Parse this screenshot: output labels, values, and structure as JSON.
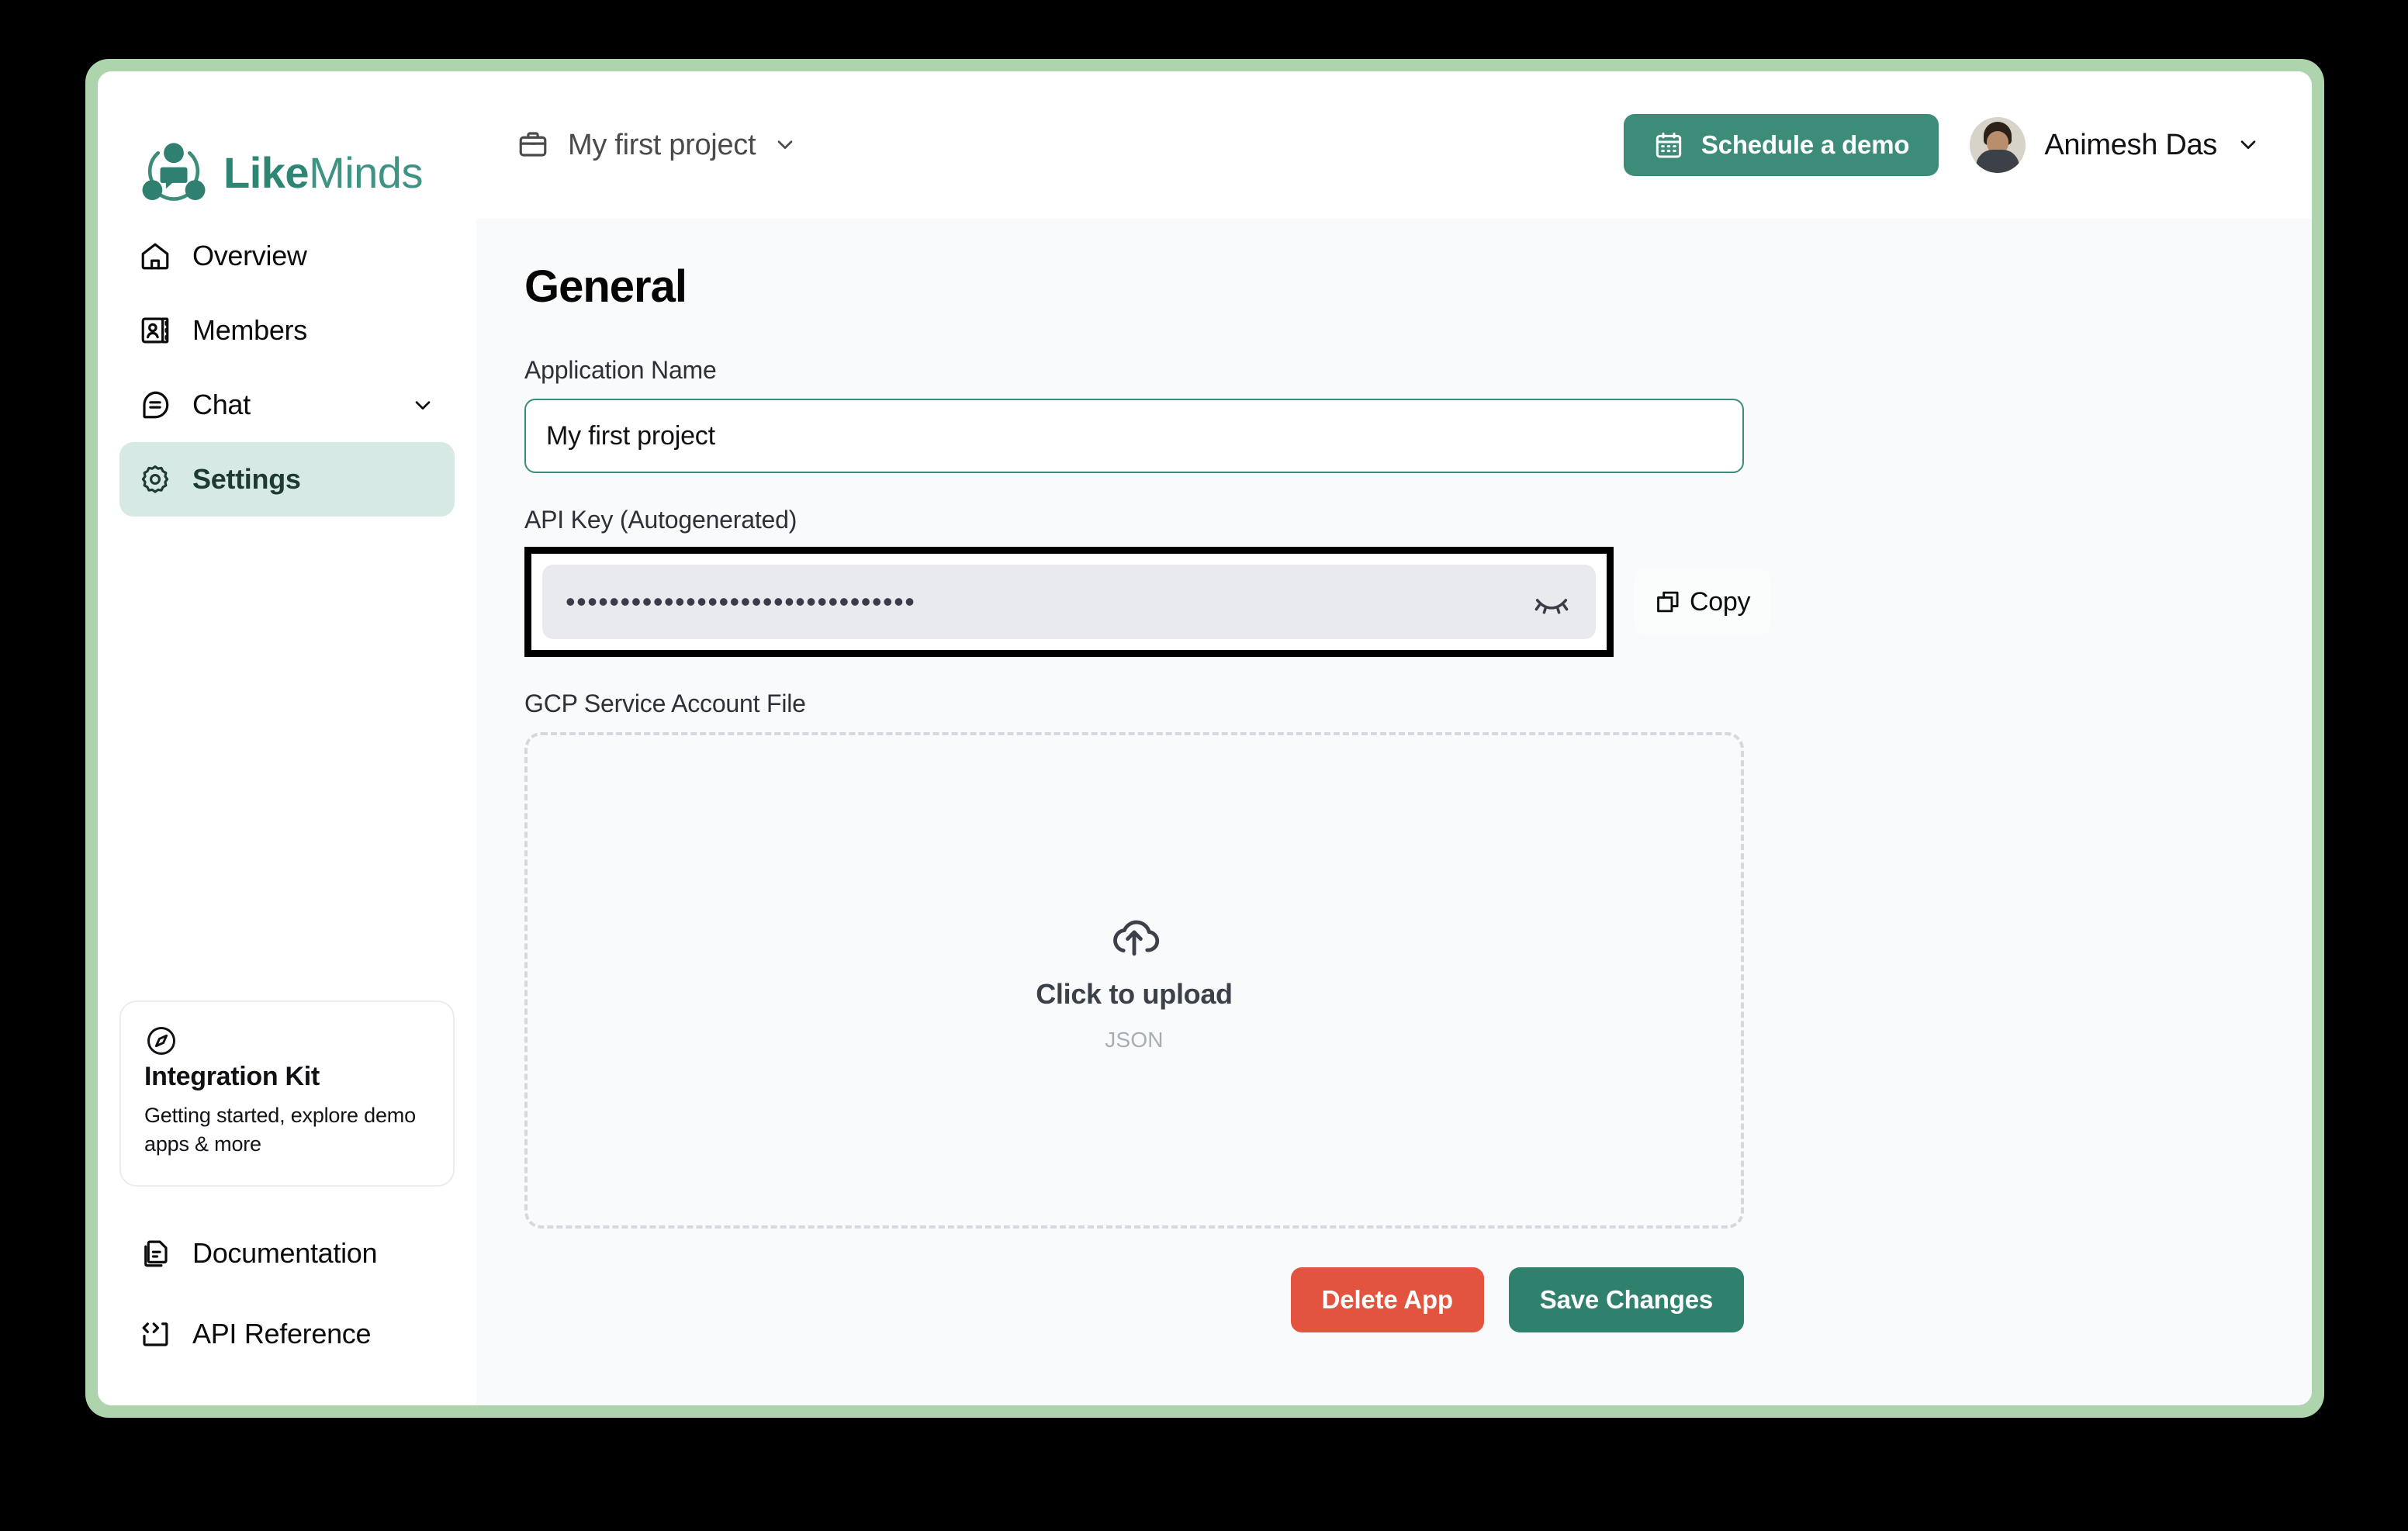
{
  "brand": {
    "name_bold": "Like",
    "name_light": "Minds",
    "logo_icon": "likeminds-logo-icon"
  },
  "sidebar": {
    "items": [
      {
        "label": "Overview",
        "icon": "home-icon",
        "active": false,
        "chevron": false
      },
      {
        "label": "Members",
        "icon": "contacts-icon",
        "active": false,
        "chevron": false
      },
      {
        "label": "Chat",
        "icon": "chat-bubble-icon",
        "active": false,
        "chevron": true
      },
      {
        "label": "Settings",
        "icon": "gear-icon",
        "active": true,
        "chevron": false
      }
    ],
    "integration_kit": {
      "icon": "compass-icon",
      "title": "Integration Kit",
      "subtitle": "Getting started, explore demo apps & more"
    },
    "bottom_items": [
      {
        "label": "Documentation",
        "icon": "document-icon"
      },
      {
        "label": "API Reference",
        "icon": "code-brackets-icon"
      }
    ]
  },
  "topbar": {
    "project": {
      "icon": "briefcase-icon",
      "name": "My first project",
      "chevron_icon": "chevron-down-icon"
    },
    "schedule_demo": {
      "label": "Schedule a demo",
      "icon": "calendar-icon"
    },
    "user": {
      "name": "Animesh Das",
      "avatar_icon": "avatar",
      "chevron_icon": "chevron-down-icon"
    }
  },
  "content": {
    "page_title": "General",
    "application_name": {
      "label": "Application Name",
      "value": "My first project",
      "placeholder": "Application Name"
    },
    "api_key": {
      "label": "API Key (Autogenerated)",
      "masked_value": "••••••••••••••••••••••••••••••••",
      "toggle_icon": "eye-off-icon",
      "copy_label": "Copy",
      "copy_icon": "copy-icon"
    },
    "gcp_file": {
      "label": "GCP Service Account File",
      "upload_icon": "cloud-upload-icon",
      "upload_primary": "Click to upload",
      "upload_hint": "JSON"
    },
    "actions": {
      "delete_label": "Delete App",
      "save_label": "Save Changes"
    }
  },
  "colors": {
    "brand_green": "#3d8b79",
    "frame_mint": "#aed4ae",
    "active_nav_bg": "#d6e9e4",
    "danger_red": "#e2543f",
    "save_green": "#30806e",
    "content_bg": "#f8fafb"
  }
}
